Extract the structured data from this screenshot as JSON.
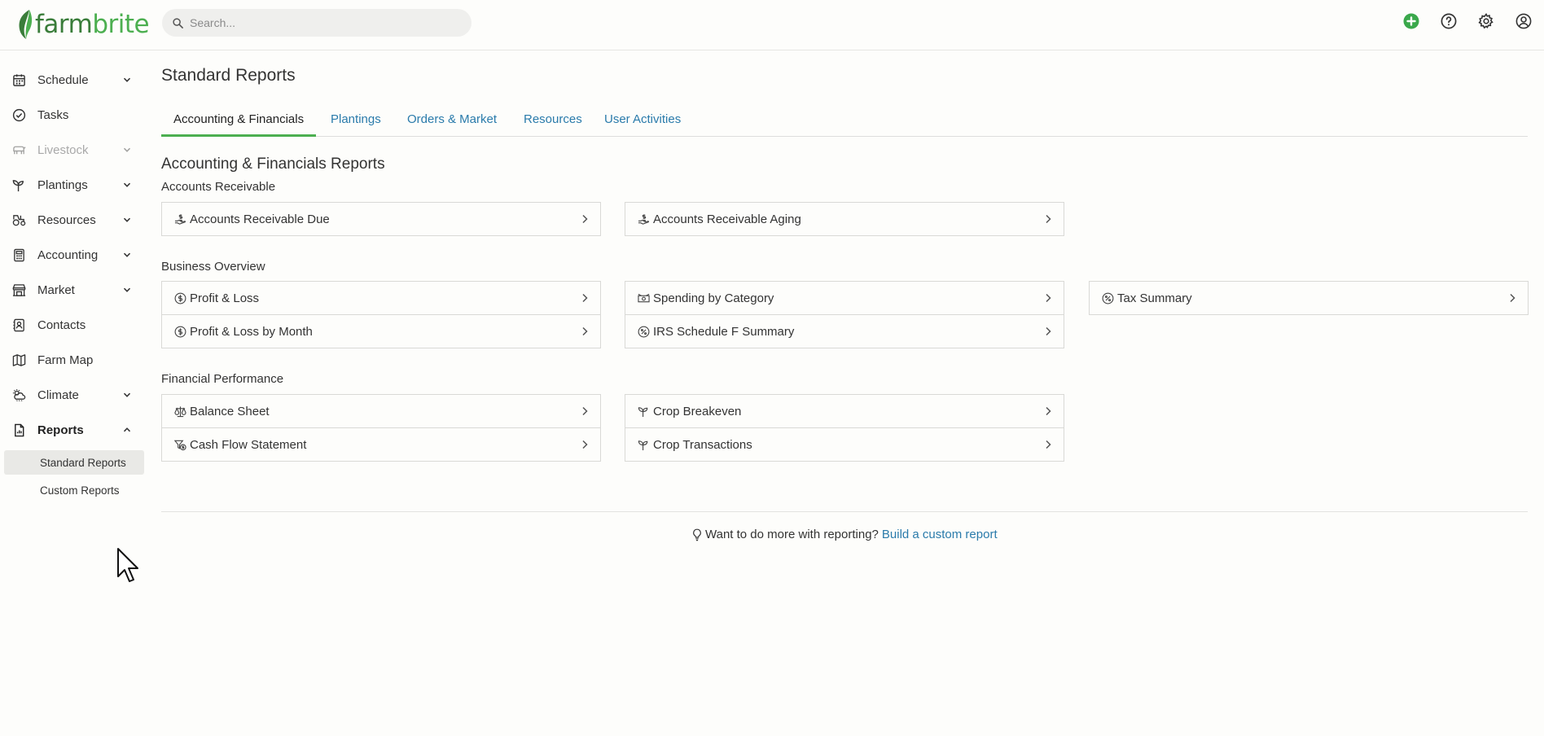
{
  "app": {
    "logo_part1": "farm",
    "logo_part2": "brite"
  },
  "header": {
    "search_placeholder": "Search...",
    "icons": [
      "add-circle-icon",
      "help-icon",
      "gear-icon",
      "user-icon"
    ],
    "accent_color": "#3aa84b"
  },
  "sidebar": {
    "items": [
      {
        "label": "Schedule",
        "icon": "calendar-icon",
        "expandable": true
      },
      {
        "label": "Tasks",
        "icon": "check-circle-icon",
        "expandable": false
      },
      {
        "label": "Livestock",
        "icon": "livestock-icon",
        "expandable": true,
        "disabled": true
      },
      {
        "label": "Plantings",
        "icon": "sprout-icon",
        "expandable": true
      },
      {
        "label": "Resources",
        "icon": "tractor-icon",
        "expandable": true
      },
      {
        "label": "Accounting",
        "icon": "calculator-icon",
        "expandable": true
      },
      {
        "label": "Market",
        "icon": "market-icon",
        "expandable": true
      },
      {
        "label": "Contacts",
        "icon": "contact-card-icon",
        "expandable": false
      },
      {
        "label": "Farm Map",
        "icon": "map-icon",
        "expandable": false
      },
      {
        "label": "Climate",
        "icon": "weather-icon",
        "expandable": true
      },
      {
        "label": "Reports",
        "icon": "report-icon",
        "expandable": true,
        "expanded": true
      }
    ],
    "sub_items": [
      {
        "label": "Standard Reports",
        "active": true
      },
      {
        "label": "Custom Reports",
        "active": false
      }
    ]
  },
  "main": {
    "page_title": "Standard Reports",
    "tabs": [
      {
        "label": "Accounting & Financials",
        "active": true
      },
      {
        "label": "Plantings"
      },
      {
        "label": "Orders & Market"
      },
      {
        "label": "Resources"
      },
      {
        "label": "User Activities"
      }
    ],
    "section_title": "Accounting & Financials Reports",
    "groups": [
      {
        "title": "Accounts Receivable",
        "reports": [
          {
            "label": "Accounts Receivable Due",
            "icon": "hand-money-icon"
          },
          {
            "label": "Accounts Receivable Aging",
            "icon": "hand-money-icon"
          }
        ]
      },
      {
        "title": "Business Overview",
        "reports": [
          {
            "label": "Profit & Loss",
            "icon": "dollar-circle-icon"
          },
          {
            "label": "Profit & Loss by Month",
            "icon": "dollar-circle-icon"
          },
          {
            "label": "Spending by Category",
            "icon": "money-bill-icon"
          },
          {
            "label": "IRS Schedule F Summary",
            "icon": "percent-circle-icon"
          },
          {
            "label": "Tax Summary",
            "icon": "percent-circle-icon"
          }
        ]
      },
      {
        "title": "Financial Performance",
        "reports": [
          {
            "label": "Balance Sheet",
            "icon": "scale-icon"
          },
          {
            "label": "Cash Flow Statement",
            "icon": "cash-flow-icon"
          },
          {
            "label": "Crop Breakeven",
            "icon": "sprout-icon"
          },
          {
            "label": "Crop Transactions",
            "icon": "sprout-icon"
          }
        ]
      }
    ],
    "footer": {
      "hint": "Want to do more with reporting?",
      "link": "Build a custom report"
    }
  }
}
